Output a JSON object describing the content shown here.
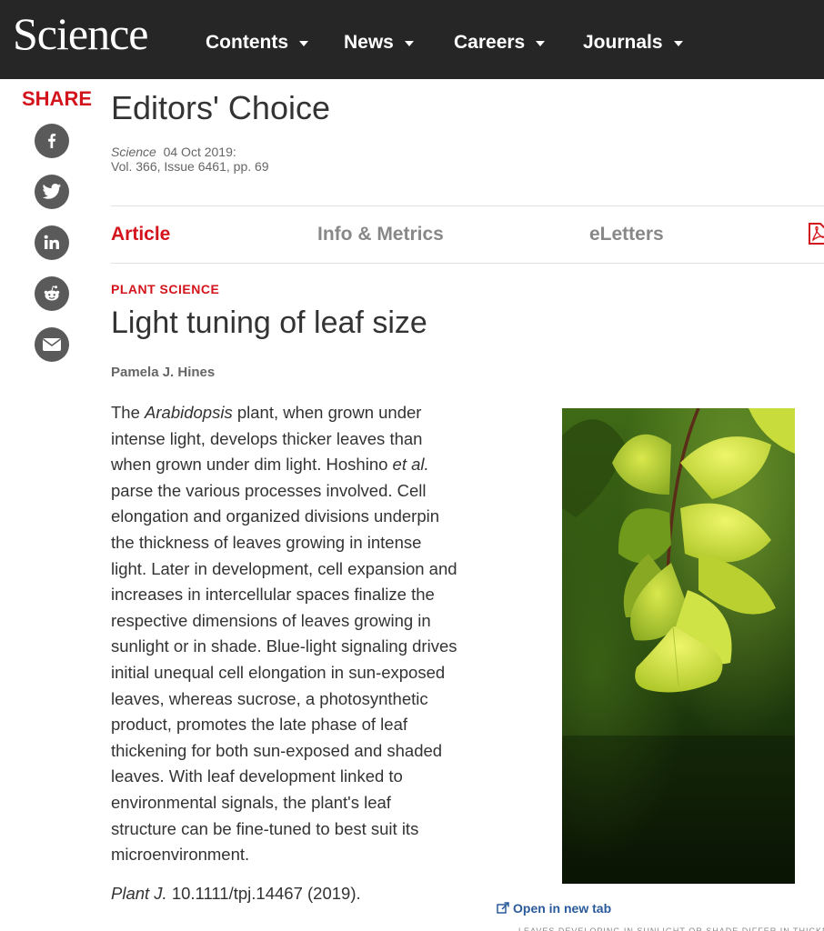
{
  "header": {
    "logo": "Science",
    "nav": [
      {
        "label": "Contents"
      },
      {
        "label": "News"
      },
      {
        "label": "Careers"
      },
      {
        "label": "Journals"
      }
    ]
  },
  "share": {
    "label": "SHARE",
    "buttons": [
      "facebook-icon",
      "twitter-icon",
      "linkedin-icon",
      "reddit-icon",
      "email-icon"
    ]
  },
  "page": {
    "section_title": "Editors' Choice",
    "journal": "Science",
    "date": "04 Oct 2019:",
    "volume": "Vol. 366, Issue 6461, pp. 69"
  },
  "tabs": [
    {
      "label": "Article",
      "active": true
    },
    {
      "label": "Info & Metrics",
      "active": false
    },
    {
      "label": "eLetters",
      "active": false
    }
  ],
  "article": {
    "kicker": "PLANT SCIENCE",
    "title": "Light tuning of leaf size",
    "author": "Pamela J. Hines",
    "body": {
      "p1": "The ",
      "species": "Arabidopsis",
      "p2": " plant, when grown under intense light, develops thicker leaves than when grown under dim light. Hoshino ",
      "etal": "et al.",
      "p3": " parse the various processes involved. Cell elongation and organized divisions underpin the thickness of leaves growing in intense light. Later in development, cell expansion and increases in intercellular spaces finalize the respective dimensions of leaves growing in sunlight or in shade. Blue-light signaling drives initial unequal cell elongation in sun-exposed leaves, whereas sucrose, a photosynthetic product, promotes the late phase of leaf thickening for both sun-exposed and shaded leaves. With leaf development linked to environmental signals, the plant's leaf structure can be fine-tuned to best suit its microenvironment."
    },
    "reference": {
      "journal": "Plant J.",
      "doi": " 10.1111/tpj.14467 (2019)."
    }
  },
  "figure": {
    "open_label": "Open in new tab",
    "caption_cut": "LEAVES DEVELOPING IN SUNLIGHT OR SHADE DIFFER IN THICKNESS"
  },
  "colors": {
    "brand_red": "#d4141c",
    "topbar": "#262626",
    "share_icon_bg": "#5a5a5a",
    "link_blue": "#2a5a9a"
  }
}
